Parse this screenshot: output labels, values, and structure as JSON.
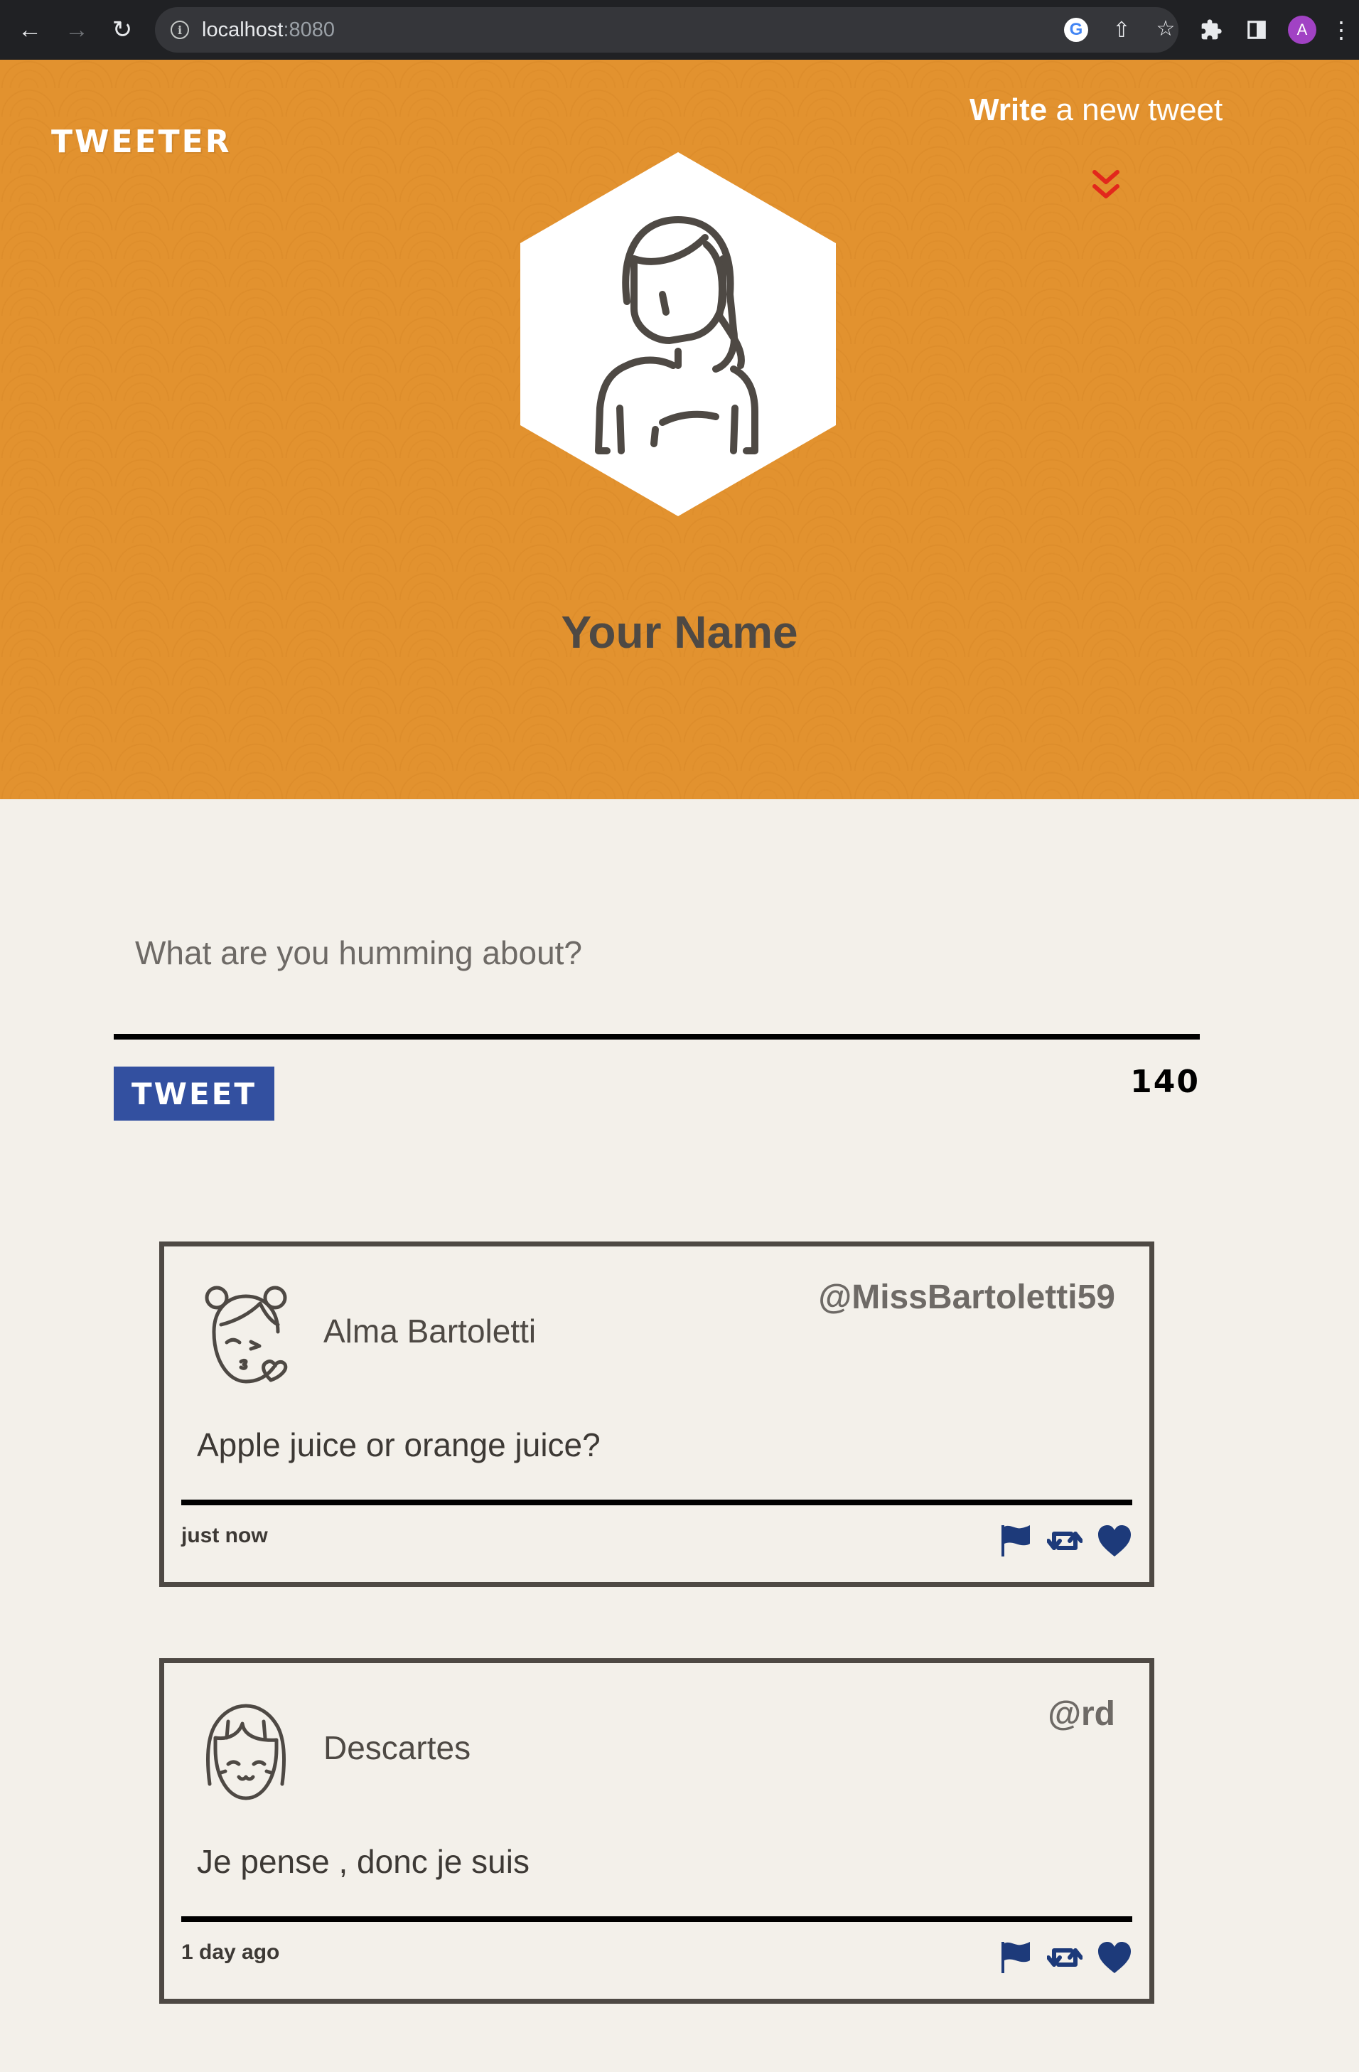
{
  "browser": {
    "url_host": "localhost",
    "url_port": ":8080",
    "profile_initial": "A"
  },
  "header": {
    "logo": "TWEETER",
    "write_bold": "Write",
    "write_rest": " a new tweet",
    "user_name": "Your Name"
  },
  "compose": {
    "placeholder": "What are you humming about?",
    "button_label": "TWEET",
    "counter": "140"
  },
  "colors": {
    "header_bg": "#e2922f",
    "page_bg": "#f3f0ea",
    "button_bg": "#3350a0",
    "action_icon": "#1d3a7a",
    "chevron": "#e2271c"
  },
  "tweets": [
    {
      "name": "Alma Bartoletti",
      "handle": "@MissBartoletti59",
      "content": "Apple juice or orange juice?",
      "time": "just now",
      "avatar_icon": "girl-buns-kiss-icon"
    },
    {
      "name": "Descartes",
      "handle": "@rd",
      "content": "Je pense , donc je suis",
      "time": "1 day ago",
      "avatar_icon": "girl-bangs-smile-icon"
    }
  ]
}
